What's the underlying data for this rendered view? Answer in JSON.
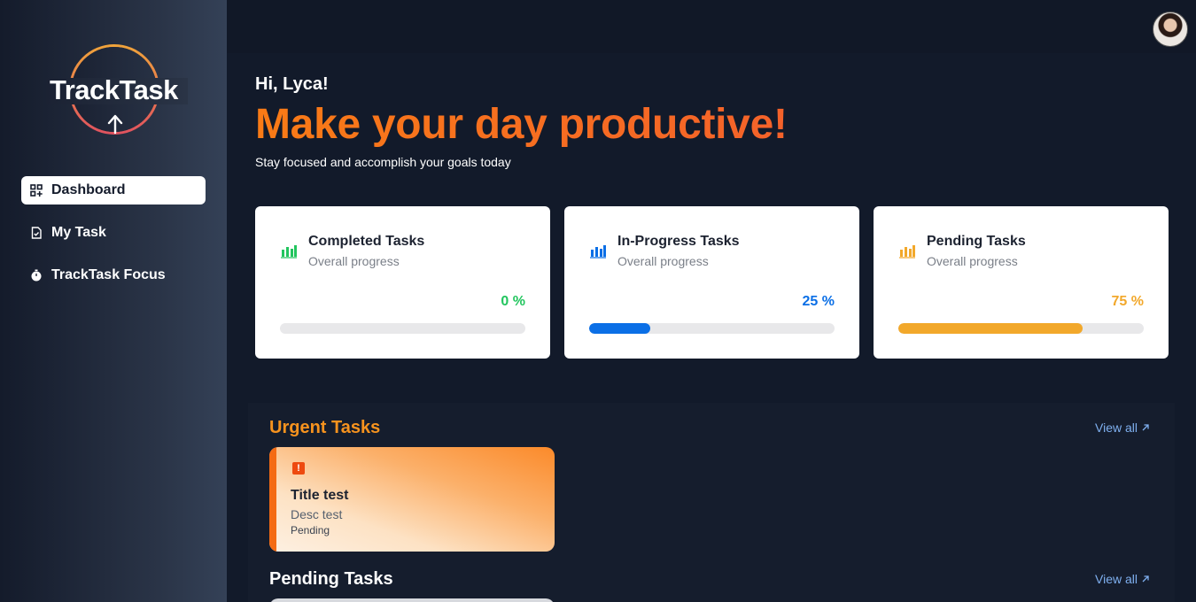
{
  "sidebar": {
    "logo_text": "TrackTask",
    "items": [
      {
        "label": "Dashboard",
        "icon": "grid-plus-icon",
        "active": true
      },
      {
        "label": "My Task",
        "icon": "file-check-icon",
        "active": false
      },
      {
        "label": "TrackTask Focus",
        "icon": "stopwatch-icon",
        "active": false
      }
    ]
  },
  "header": {
    "greeting": "Hi, Lyca!",
    "headline": "Make your day productive!",
    "subline": "Stay focused and accomplish your goals today"
  },
  "stats": [
    {
      "title": "Completed Tasks",
      "subtitle": "Overall progress",
      "percent_label": "0 %",
      "percent": 0,
      "color": "#22c55e"
    },
    {
      "title": "In-Progress Tasks",
      "subtitle": "Overall progress",
      "percent_label": "25 %",
      "percent": 25,
      "color": "#0b6fe6"
    },
    {
      "title": "Pending Tasks",
      "subtitle": "Overall progress",
      "percent_label": "75 %",
      "percent": 75,
      "color": "#f2a82b"
    }
  ],
  "urgent": {
    "title": "Urgent Tasks",
    "title_color": "#f7931e",
    "view_all": "View all",
    "tasks": [
      {
        "title": "Title test",
        "desc": "Desc test",
        "status": "Pending"
      }
    ]
  },
  "pending": {
    "title": "Pending Tasks",
    "view_all": "View all"
  }
}
